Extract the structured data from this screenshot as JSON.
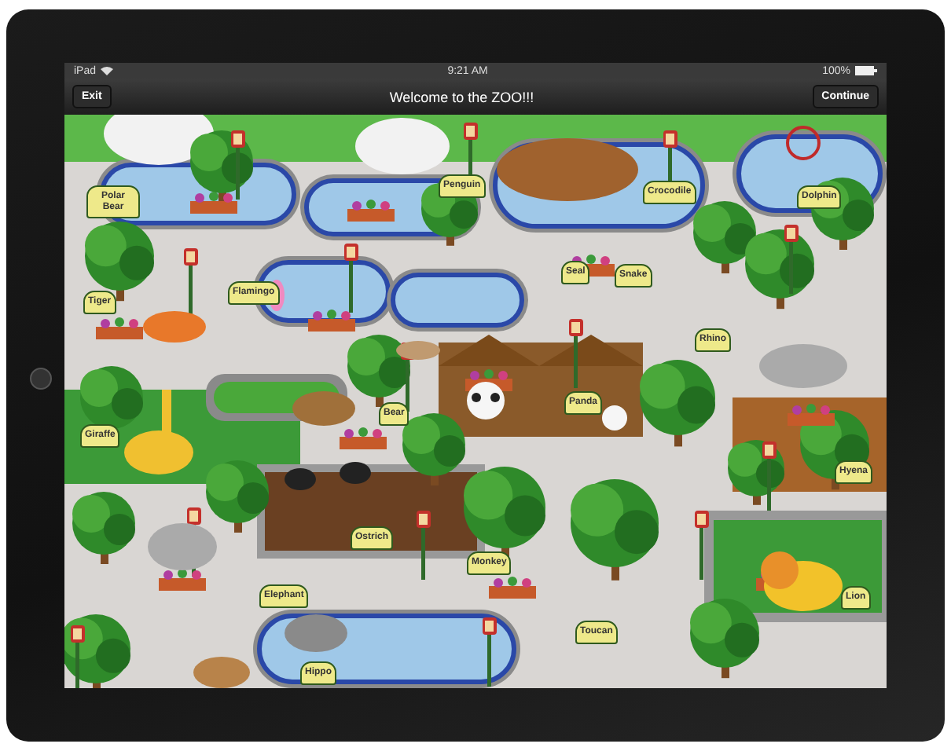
{
  "status_bar": {
    "carrier": "iPad",
    "time": "9:21 AM",
    "battery": "100%"
  },
  "nav_bar": {
    "left_button": "Exit",
    "title": "Welcome to the ZOO!!!",
    "right_button": "Continue"
  },
  "map": {
    "signs": [
      {
        "label": "Polar Bear"
      },
      {
        "label": "Penguin"
      },
      {
        "label": "Crocodile"
      },
      {
        "label": "Dolphin"
      },
      {
        "label": "Tiger"
      },
      {
        "label": "Flamingo"
      },
      {
        "label": "Seal"
      },
      {
        "label": "Snake"
      },
      {
        "label": "Rhino"
      },
      {
        "label": "Panda"
      },
      {
        "label": "Giraffe"
      },
      {
        "label": "Bear"
      },
      {
        "label": "Hyena"
      },
      {
        "label": "Ostrich"
      },
      {
        "label": "Monkey"
      },
      {
        "label": "Elephant"
      },
      {
        "label": "Toucan"
      },
      {
        "label": "Lion"
      },
      {
        "label": "Hippo"
      }
    ]
  }
}
